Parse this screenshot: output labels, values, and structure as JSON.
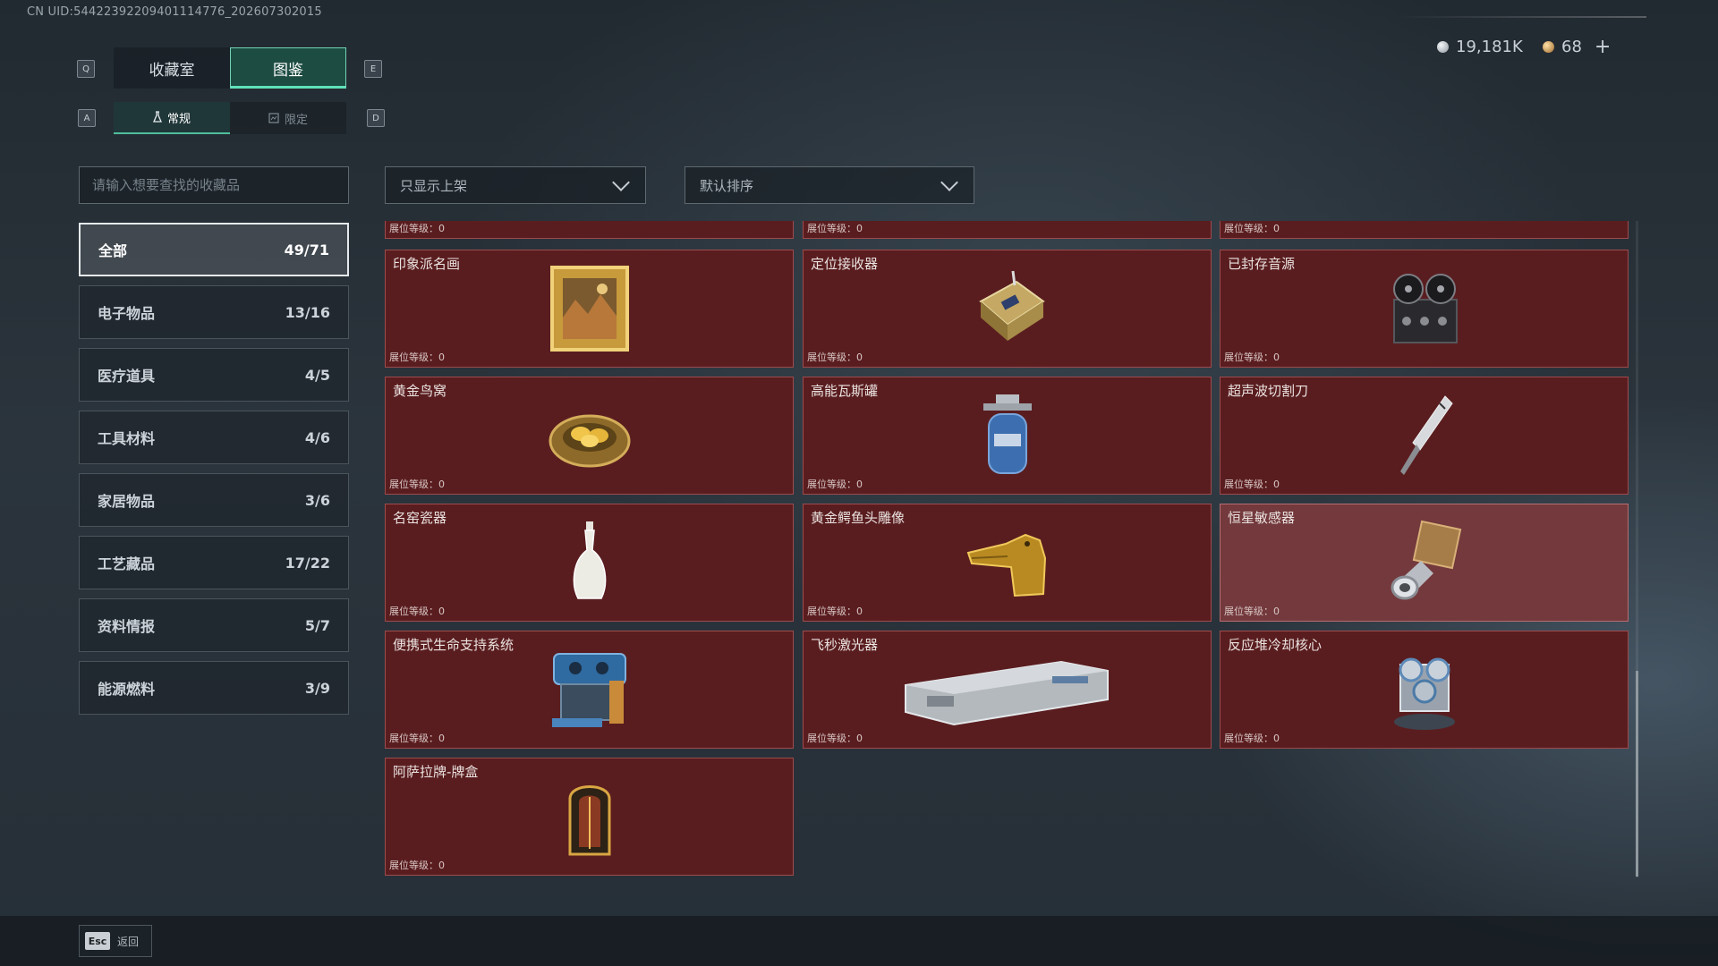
{
  "uid_text": "CN UID:544223922094011147​76_202607302015",
  "currency": {
    "silver": "19,181K",
    "gold": "68",
    "add_symbol": "+"
  },
  "keys": {
    "prev_tab": "Q",
    "next_tab": "E",
    "prev_sub": "A",
    "next_sub": "D"
  },
  "tabs": [
    {
      "label": "收藏室"
    },
    {
      "label": "图鉴"
    }
  ],
  "subtabs": [
    {
      "label": "常规"
    },
    {
      "label": "限定"
    }
  ],
  "search": {
    "placeholder": "请输入想要查找的收藏品"
  },
  "filters": {
    "shelf": "只显示上架",
    "sort": "默认排序"
  },
  "categories": [
    {
      "label": "全部",
      "count": "49/71"
    },
    {
      "label": "电子物品",
      "count": "13/16"
    },
    {
      "label": "医疗道具",
      "count": "4/5"
    },
    {
      "label": "工具材料",
      "count": "4/6"
    },
    {
      "label": "家居物品",
      "count": "3/6"
    },
    {
      "label": "工艺藏品",
      "count": "17/22"
    },
    {
      "label": "资料情报",
      "count": "5/7"
    },
    {
      "label": "能源燃料",
      "count": "3/9"
    }
  ],
  "level_label": "展位等级：0",
  "items": [
    {
      "name": "印象派名画",
      "icon": "painting-icon"
    },
    {
      "name": "定位接收器",
      "icon": "receiver-icon"
    },
    {
      "name": "已封存音源",
      "icon": "tape-recorder-icon"
    },
    {
      "name": "黄金鸟窝",
      "icon": "golden-nest-icon"
    },
    {
      "name": "高能瓦斯罐",
      "icon": "gas-tank-icon"
    },
    {
      "name": "超声波切割刀",
      "icon": "ultrasonic-knife-icon"
    },
    {
      "name": "名窑瓷器",
      "icon": "porcelain-vase-icon"
    },
    {
      "name": "黄金鳄鱼头雕像",
      "icon": "crocodile-statue-icon"
    },
    {
      "name": "恒星敏感器",
      "icon": "star-sensor-icon"
    },
    {
      "name": "便携式生命支持系统",
      "icon": "life-support-icon"
    },
    {
      "name": "飞秒激光器",
      "icon": "laser-device-icon"
    },
    {
      "name": "反应堆冷却核心",
      "icon": "reactor-core-icon"
    },
    {
      "name": "阿萨拉牌-牌盒",
      "icon": "card-box-icon"
    }
  ],
  "back": {
    "key": "Esc",
    "label": "返回"
  }
}
